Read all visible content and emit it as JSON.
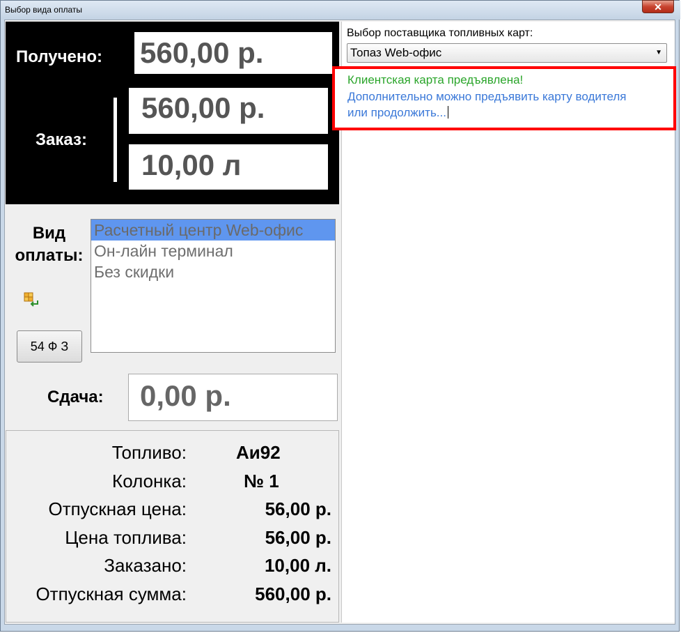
{
  "window": {
    "title": "Выбор вида оплаты",
    "close_label": "✕"
  },
  "summary": {
    "received_label": "Получено:",
    "received_value": "560,00 р.",
    "order_label": "Заказ:",
    "order_amount": "560,00 р.",
    "order_volume": "10,00 л"
  },
  "payment": {
    "label_line1": "Вид",
    "label_line2": "оплаты:",
    "options": [
      {
        "label": "Расчетный центр Web-офис",
        "selected": true
      },
      {
        "label": "Он-лайн терминал",
        "selected": false
      },
      {
        "label": "Без скидки",
        "selected": false
      }
    ],
    "fz_button_label": "54 Ф З",
    "change_label": "Сдача:",
    "change_value": "0,00 р."
  },
  "details": [
    {
      "label": "Топливо:",
      "value": "Аи92"
    },
    {
      "label": "Колонка:",
      "value": "№ 1"
    },
    {
      "label": "Отпускная цена:",
      "value": "56,00 р."
    },
    {
      "label": "Цена топлива:",
      "value": "56,00 р."
    },
    {
      "label": "Заказано:",
      "value": "10,00 л."
    },
    {
      "label": "Отпускная сумма:",
      "value": "560,00 р."
    }
  ],
  "supplier": {
    "label": "Выбор поставщика топливных карт:",
    "selected": "Топаз Web-офис"
  },
  "message": {
    "line1": "Клиентская карта предъявлена!",
    "line2": "Дополнительно можно предъявить карту водителя",
    "line3": "или продолжить..."
  },
  "colors": {
    "highlight_border": "#ff0000",
    "selected_item": "#5f96ef",
    "message_green": "#2aa52a",
    "message_blue": "#3a78d8"
  }
}
